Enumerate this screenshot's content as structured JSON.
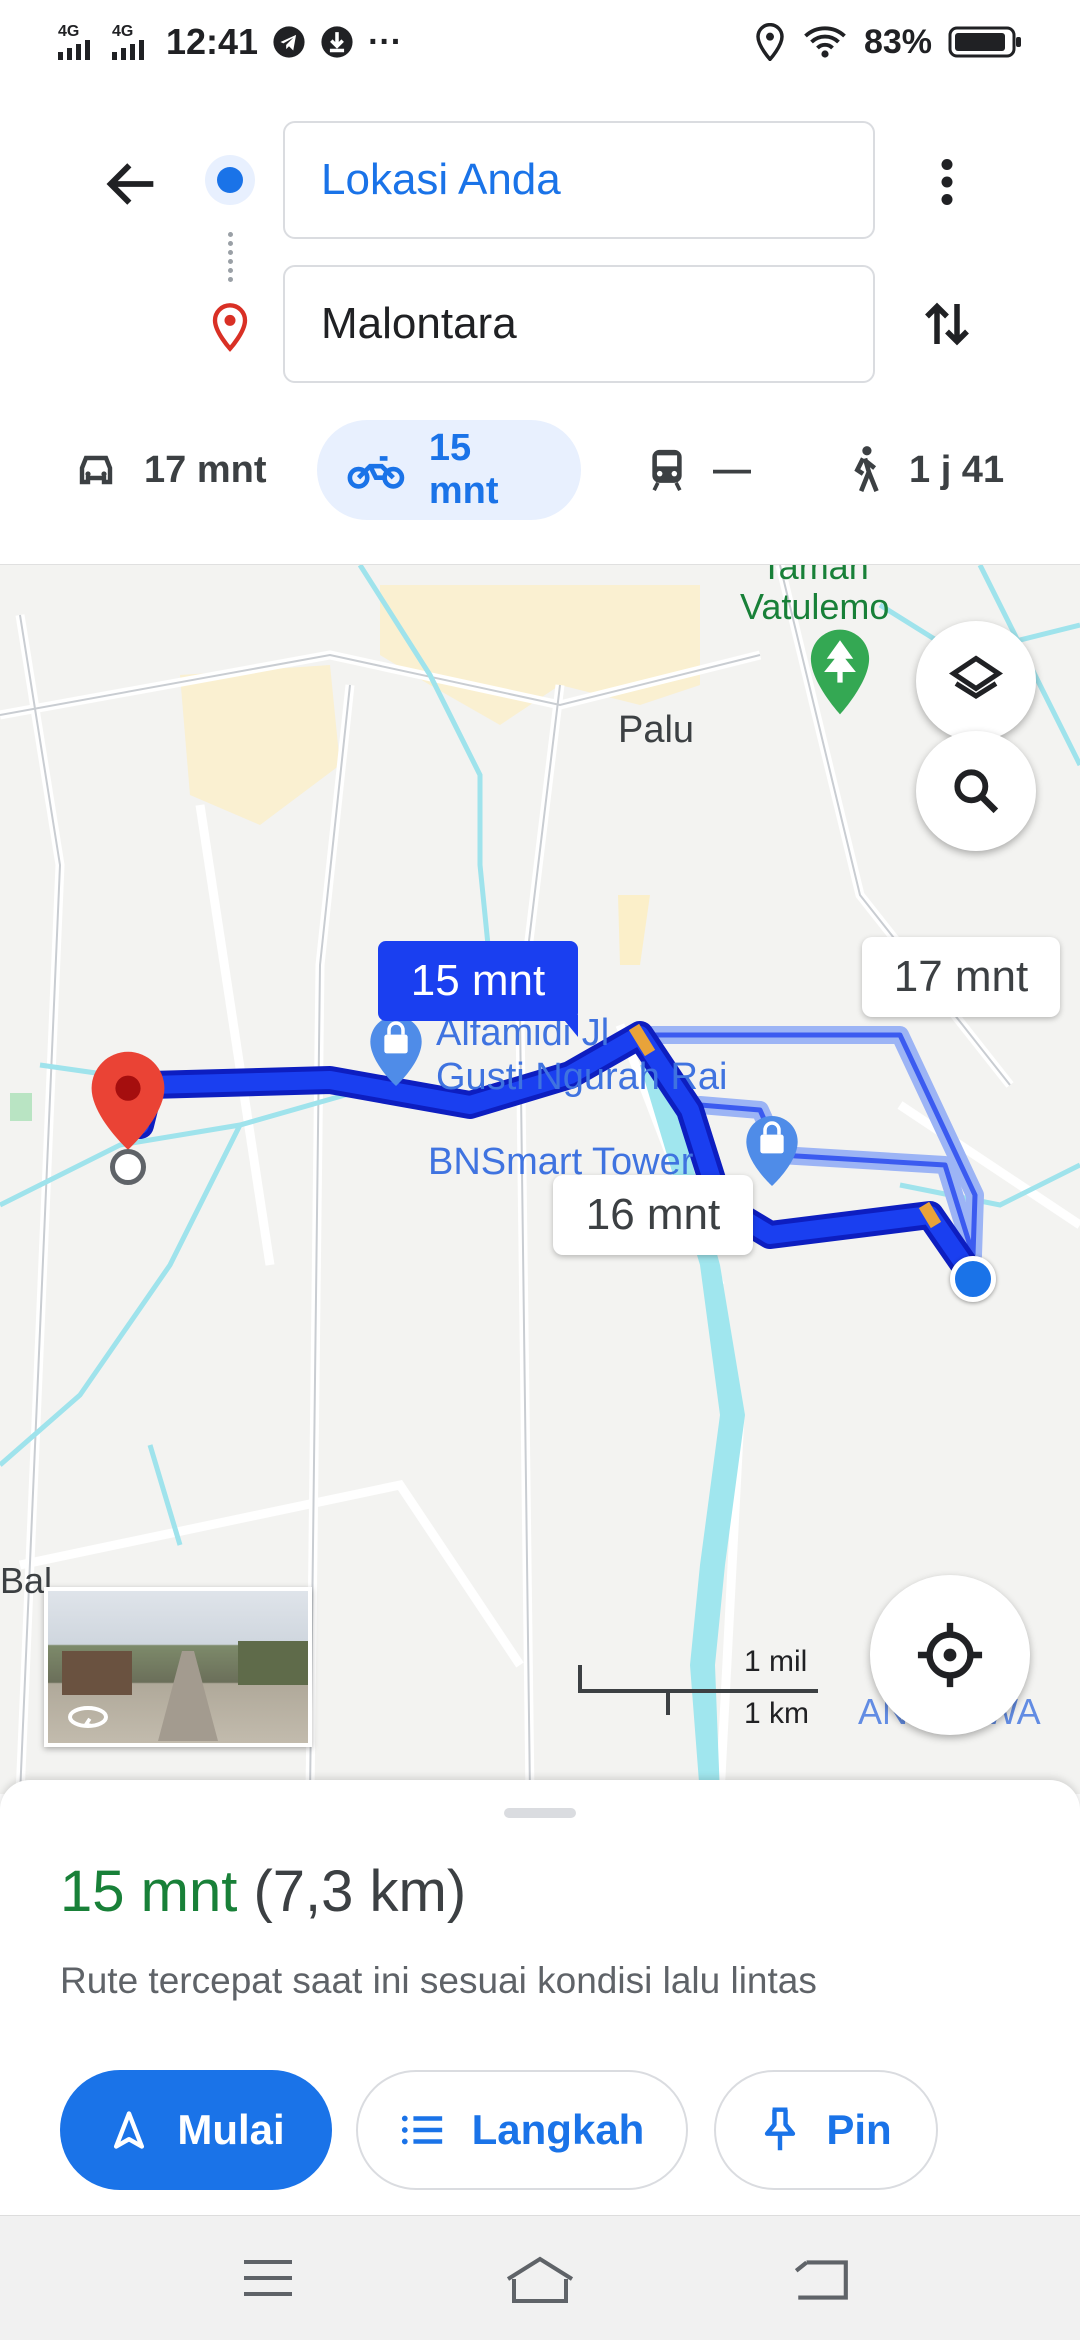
{
  "status_bar": {
    "signal1": "4G",
    "signal2": "4G",
    "time": "12:41",
    "battery": "83%"
  },
  "header": {
    "origin": "Lokasi Anda",
    "destination": "Malontara"
  },
  "modes": [
    {
      "label": "17 mnt",
      "icon": "car-icon"
    },
    {
      "label": "15 mnt",
      "icon": "motorcycle-icon",
      "selected": true
    },
    {
      "label": "—",
      "icon": "transit-icon"
    },
    {
      "label": "1 j 41",
      "icon": "walk-icon"
    }
  ],
  "map": {
    "labels": {
      "taman_top": "Taman",
      "taman": "Vatulemo",
      "city": "Palu",
      "poi1_line1": "Alfamidi Jl",
      "poi1_line2": "Gusti Ngurah Rai",
      "poi2": "BNSmart Tower",
      "left_edge": "Bal",
      "right_edge": "ANGASWA"
    },
    "route_badges": {
      "selected": "15 mnt",
      "alt1": "17 mnt",
      "alt2": "16 mnt"
    },
    "scale": {
      "mil": "1 mil",
      "km": "1 km"
    },
    "colors": {
      "route": "#1a3ff0",
      "route_alt": "#9cb4f5",
      "water": "#9fe3ec",
      "park": "#34a853"
    }
  },
  "sheet": {
    "duration": "15 mnt",
    "distance": "(7,3 km)",
    "description": "Rute tercepat saat ini sesuai kondisi lalu lintas",
    "buttons": {
      "start": "Mulai",
      "steps": "Langkah",
      "pin": "Pin"
    }
  }
}
